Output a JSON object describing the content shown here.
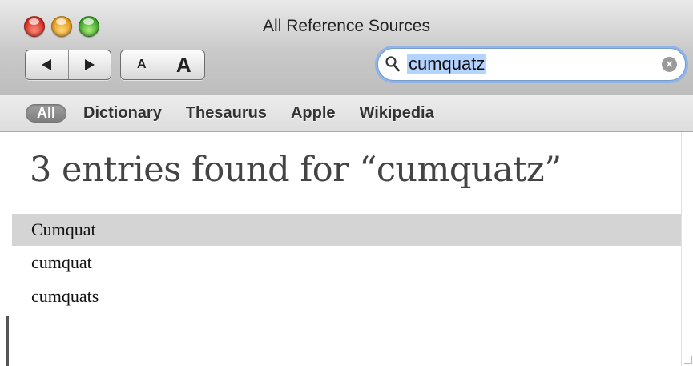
{
  "window": {
    "title": "All Reference Sources"
  },
  "toolbar": {
    "font_small_label": "A",
    "font_large_label": "A"
  },
  "search": {
    "value": "cumquatz",
    "clear_glyph": "×"
  },
  "scopes": [
    {
      "label": "All",
      "selected": true
    },
    {
      "label": "Dictionary"
    },
    {
      "label": "Thesaurus"
    },
    {
      "label": "Apple"
    },
    {
      "label": "Wikipedia"
    }
  ],
  "main": {
    "heading": "3 entries found for “cumquatz”",
    "results": [
      {
        "label": "Cumquat",
        "selected": true
      },
      {
        "label": "cumquat"
      },
      {
        "label": "cumquats"
      }
    ]
  },
  "colors": {
    "selection": "#d4d4d4",
    "search_highlight": "#b5d3ff",
    "focus_ring": "#8fb4e8"
  },
  "icons": [
    "close-button",
    "minimize-button",
    "zoom-button",
    "back-arrow-icon",
    "forward-arrow-icon",
    "search-icon",
    "clear-icon"
  ]
}
